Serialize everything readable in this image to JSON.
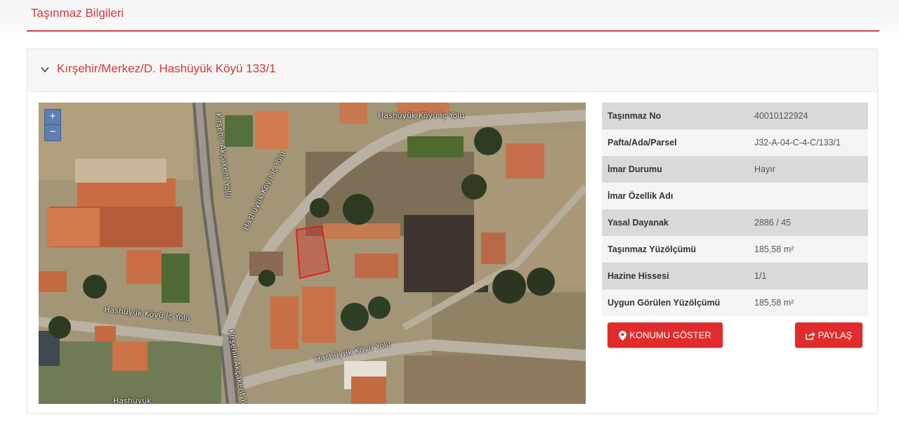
{
  "page": {
    "title": "Taşınmaz Bilgileri"
  },
  "panel": {
    "title": "Kırşehir/Merkez/D. Hashüyük Köyü 133/1"
  },
  "map": {
    "zoom_in": "+",
    "zoom_out": "−",
    "road_labels": {
      "top": "Hashüyük Köyü İç Yolu",
      "vertical_left": "Kırşehir Akçakent Yolu",
      "diag": "Hashüyük Köyü İç Yolu",
      "bottom_left": "Hashüyük Köyü İç Yolu",
      "bottom_vertical": "Kırşehir Akçakent Yolu",
      "bottom_diag": "Hashüyük Köyü Yolu",
      "bottom_edge": "Hashüyük"
    }
  },
  "info": {
    "rows": [
      {
        "key": "Taşınmaz No",
        "value": "40010122924"
      },
      {
        "key": "Pafta/Ada/Parsel",
        "value": "J32-A-04-C-4-C/133/1"
      },
      {
        "key": "İmar Durumu",
        "value": "Hayır"
      },
      {
        "key": "İmar Özellik Adı",
        "value": ""
      },
      {
        "key": "Yasal Dayanak",
        "value": "2886 / 45"
      },
      {
        "key": "Taşınmaz Yüzölçümü",
        "value": "185,58 m²"
      },
      {
        "key": "Hazine Hissesi",
        "value": "1/1"
      },
      {
        "key": "Uygun Görülen Yüzölçümü",
        "value": "185,58 m²"
      }
    ]
  },
  "buttons": {
    "location": "KONUMU GÖSTER",
    "share": "PAYLAŞ"
  },
  "colors": {
    "accent": "#d0393a",
    "button": "#e02c2c",
    "parcel": "#e02020"
  },
  "icons": {
    "chevron": "chevron-down-icon",
    "marker": "map-marker-icon",
    "share": "share-icon"
  }
}
